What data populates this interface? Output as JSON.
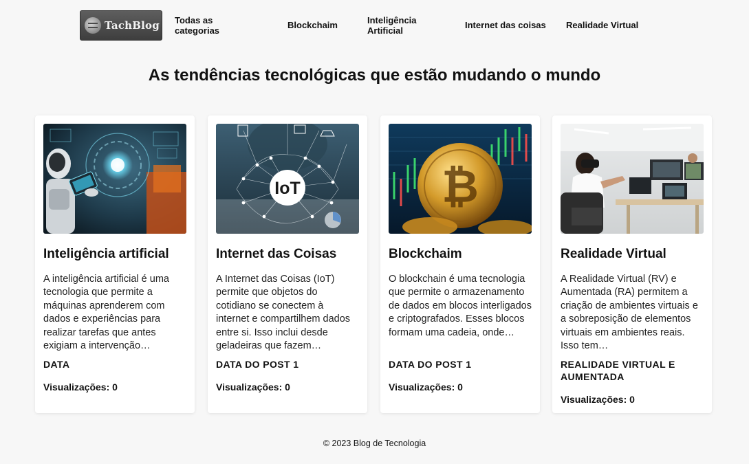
{
  "header": {
    "logo_text": "TachBlog",
    "nav": [
      {
        "label": "Todas as categorias"
      },
      {
        "label": "Blockchaim"
      },
      {
        "label": "Inteligência Artificial"
      },
      {
        "label": "Internet das coisas"
      },
      {
        "label": "Realidade Virtual"
      }
    ]
  },
  "main": {
    "title": "As tendências tecnológicas que estão mudando o mundo",
    "posts": [
      {
        "title": "Inteligência artificial",
        "description": "A inteligência artificial é uma tecnologia que permite a máquinas aprenderem com dados e experiências para realizar tarefas que antes exigiam a intervenção…",
        "category": "DATA",
        "views": "Visualizações: 0",
        "image": "robot-ai-illustration"
      },
      {
        "title": "Internet das Coisas",
        "description": "A Internet das Coisas (IoT) permite que objetos do cotidiano se conectem à internet e compartilhem dados entre si. Isso inclui desde geladeiras que fazem…",
        "category": "DATA DO POST 1",
        "views": "Visualizações: 0",
        "image": "iot-network-illustration",
        "image_text": "IoT"
      },
      {
        "title": "Blockchaim",
        "description": "O blockchain é uma tecnologia que permite o armazenamento de dados em blocos interligados e criptografados. Esses blocos formam uma cadeia, onde…",
        "category": "DATA DO POST 1",
        "views": "Visualizações: 0",
        "image": "bitcoin-coin-chart"
      },
      {
        "title": "Realidade Virtual",
        "description": "A Realidade Virtual (RV) e Aumentada (RA) permitem a criação de ambientes virtuais e a sobreposição de elementos virtuais em ambientes reais. Isso tem…",
        "category": "REALIDADE VIRTUAL E AUMENTADA",
        "views": "Visualizações: 0",
        "image": "vr-office-photo"
      }
    ]
  },
  "footer": {
    "text": "© 2023 Blog de Tecnologia"
  },
  "colors": {
    "background": "#f7f7f7",
    "card": "#ffffff",
    "text": "#111111",
    "logo_bg": "#4a4a4a"
  }
}
